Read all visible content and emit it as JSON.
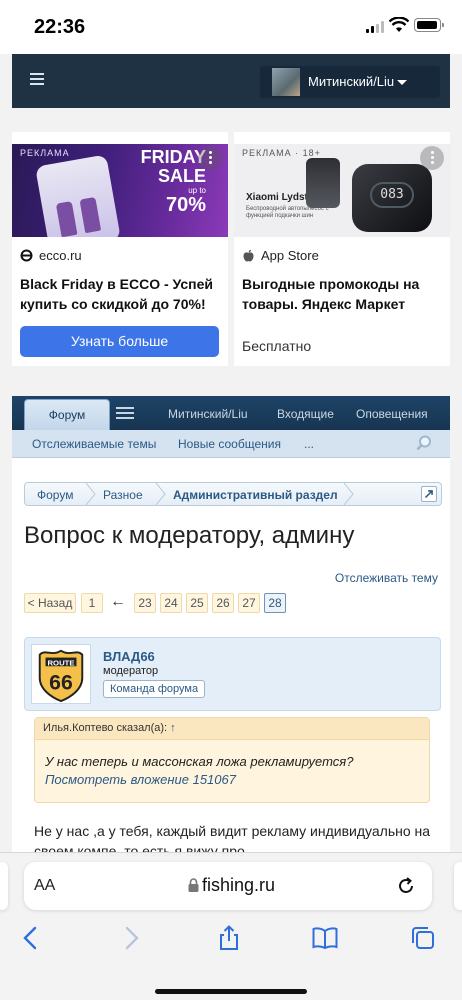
{
  "status": {
    "time": "22:36"
  },
  "header": {
    "username": "Митинский/Liu"
  },
  "ads": [
    {
      "label": "РЕКЛАМА",
      "banner": {
        "friday": "FRIDAY",
        "sale": "SALE",
        "upto": "up to",
        "percent": "70%"
      },
      "source": "ecco.ru",
      "headline": "Black Friday в ECCO - Успей купить со скидкой до 70%!",
      "cta": "Узнать больше"
    },
    {
      "label": "РЕКЛАМА · 18+",
      "banner": {
        "product": "Xiaomi Lydsto",
        "desc": "Беспроводной автопылесос с функцией подкачки шин",
        "display": "083"
      },
      "source": "App Store",
      "headline": "Выгодные промокоды на товары. Яндекс Маркет",
      "sub": "Бесплатно"
    }
  ],
  "forum": {
    "nav": {
      "active_tab": "Форум",
      "user": "Митинский/Liu",
      "inbox": "Входящие",
      "alerts": "Оповещения"
    },
    "subnav": {
      "watched": "Отслеживаемые темы",
      "new": "Новые сообщения",
      "more": "..."
    },
    "breadcrumbs": [
      "Форум",
      "Разное",
      "Административный раздел"
    ],
    "title": "Вопрос к модератору, админу",
    "watch": "Отслеживать тему",
    "pager": {
      "prev": "< Назад",
      "pages": [
        "1",
        "23",
        "24",
        "25",
        "26",
        "27",
        "28"
      ],
      "current": "28"
    },
    "post": {
      "author": "ВЛАД66",
      "role": "модератор",
      "team": "Команда форума",
      "avatar_text": {
        "top": "ROUTE",
        "num": "66"
      },
      "quote_head": "Илья.Коптево сказал(а):",
      "quote_arrow": "↑",
      "quote_text": "У нас теперь и массонская ложа рекламируется?",
      "quote_link": "Посмотреть вложение 151067",
      "body": "Не у нас ,а у тебя, каждый видит рекламу индивидуально на своем компе, то есть я вижу про"
    }
  },
  "safari": {
    "aa": "AA",
    "url": "fishing.ru"
  }
}
